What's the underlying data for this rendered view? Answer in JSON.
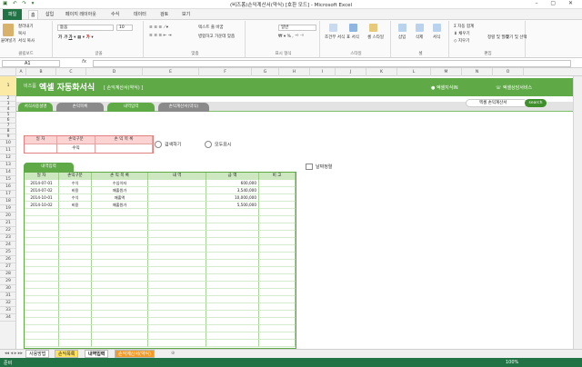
{
  "window": {
    "title": "(비즈폼)손익계산서(약식) [호환 모드] - Microsoft Excel",
    "controls": "–  ▢  ✕"
  },
  "ribbon_tabs": [
    "파일",
    "홈",
    "삽입",
    "페이지 레이아웃",
    "수식",
    "데이터",
    "검토",
    "보기"
  ],
  "ribbon": {
    "clipboard": {
      "paste": "붙여넣기",
      "cut": "잘라내기",
      "copy": "복사",
      "painter": "서식 복사",
      "label": "클립보드"
    },
    "font": {
      "name": "돋움",
      "size": "10",
      "label": "글꼴"
    },
    "align": {
      "wrap": "텍스트 줄 바꿈",
      "merge": "병합하고 가운데 맞춤",
      "label": "맞춤"
    },
    "number": {
      "format": "일반",
      "label": "표시 형식"
    },
    "styles": {
      "cond": "조건부 서식",
      "table": "표 서식",
      "cell": "셀 스타일",
      "label": "스타일"
    },
    "cells": {
      "insert": "삽입",
      "delete": "삭제",
      "format": "서식",
      "label": "셀"
    },
    "edit": {
      "autosum": "자동 합계",
      "fill": "채우기",
      "clear": "지우기",
      "sort": "정렬 및 필터",
      "find": "찾기 및 선택",
      "label": "편집"
    }
  },
  "namebox": "A1",
  "fx": "fx",
  "columns": [
    "A",
    "B",
    "C",
    "D",
    "E",
    "F",
    "G",
    "H",
    "I",
    "J",
    "K",
    "L",
    "M",
    "N",
    "O"
  ],
  "rows": [
    "1",
    "2",
    "3",
    "4",
    "5",
    "6",
    "7",
    "8",
    "9",
    "10",
    "11",
    "12",
    "13",
    "14",
    "15",
    "16",
    "17",
    "18",
    "19",
    "20",
    "21",
    "22",
    "23",
    "24",
    "25",
    "26",
    "27",
    "28",
    "29",
    "30",
    "31",
    "32",
    "33",
    "34"
  ],
  "banner": {
    "brand": "비즈폼",
    "title": "엑셀 자동화서식",
    "subtitle": "[ 손익계산서(약식) ]",
    "tag1": "엑셀지식IN",
    "tag2": "엑셀상담서비스"
  },
  "nav": [
    "서식사용설명",
    "손익목록",
    "내역입력",
    "손익계산서(약식)"
  ],
  "search": {
    "placeholder": "엑셀 손익계산서",
    "button": "search"
  },
  "criteria": {
    "headers": [
      "일 자",
      "손익구분",
      "손 익 목 록"
    ],
    "values": [
      "",
      "수익",
      ""
    ]
  },
  "buttons": {
    "search": "검색하기",
    "showall": "모두표시",
    "sort": "날짜정렬"
  },
  "section": "내역입력",
  "table": {
    "headers": [
      "일 자",
      "손익구분",
      "손 익 목 록",
      "내 역",
      "금 액",
      "비 고"
    ],
    "rows": [
      [
        "2014-07-01",
        "수익",
        "수입이자",
        "",
        "600,000",
        ""
      ],
      [
        "2014-07-02",
        "비용",
        "매출원가",
        "",
        "3,540,000",
        ""
      ],
      [
        "2014-10-01",
        "수익",
        "매출액",
        "",
        "10,000,000",
        ""
      ],
      [
        "2014-10-02",
        "비용",
        "매출원가",
        "",
        "5,500,000",
        ""
      ]
    ]
  },
  "sheet_tabs": [
    "사용방법",
    "손익목록",
    "내역입력",
    "손익계산서(약식)"
  ],
  "status": {
    "left": "준비",
    "zoom": "100%"
  },
  "colors": {
    "excel_green": "#217346",
    "brand_green": "#5faa46",
    "criteria_red": "#e08080",
    "header_green": "#cde8c0"
  }
}
